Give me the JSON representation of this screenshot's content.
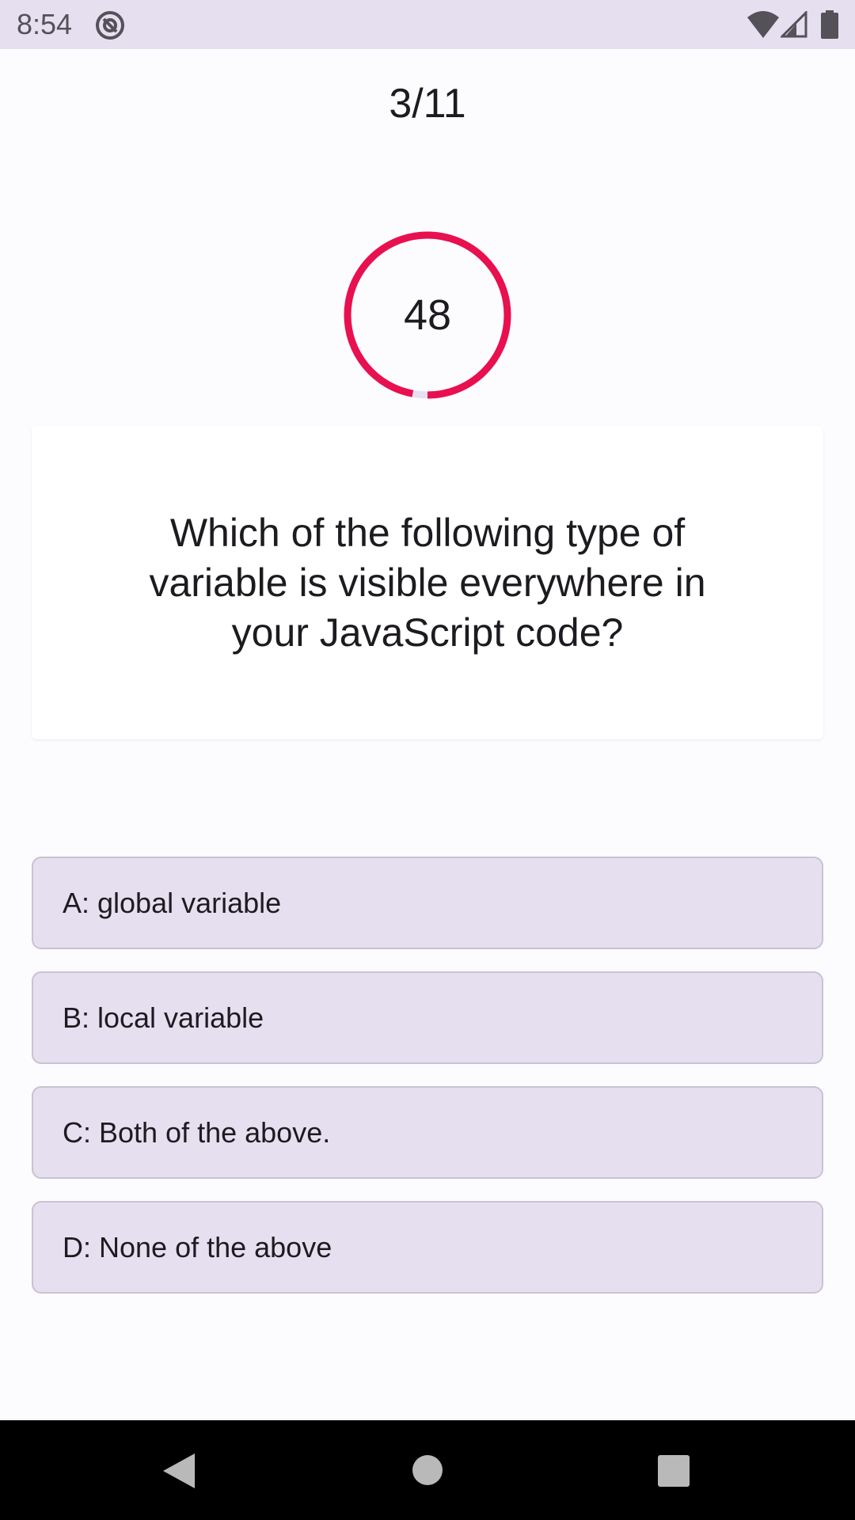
{
  "status_bar": {
    "time": "8:54",
    "icons": [
      "at-sign-icon",
      "wifi-icon",
      "cell-signal-icon",
      "battery-icon"
    ]
  },
  "quiz": {
    "progress": "3/11",
    "timer_value": "48",
    "timer_fraction_remaining": 0.97,
    "question": "Which of the following type of variable is visible everywhere in your JavaScript code?",
    "options": [
      "A: global variable",
      "B: local variable",
      "C: Both of the above.",
      "D: None of the above"
    ]
  },
  "nav_bar": {
    "icons": [
      "back-icon",
      "home-icon",
      "recents-icon"
    ]
  },
  "colors": {
    "status_bar_bg": "#e6dff0",
    "timer_ring": "#e8104f",
    "timer_track": "#e6dff0",
    "option_bg": "#e6dff0",
    "option_border": "#c9c2d2",
    "nav_bar_bg": "#000000"
  }
}
